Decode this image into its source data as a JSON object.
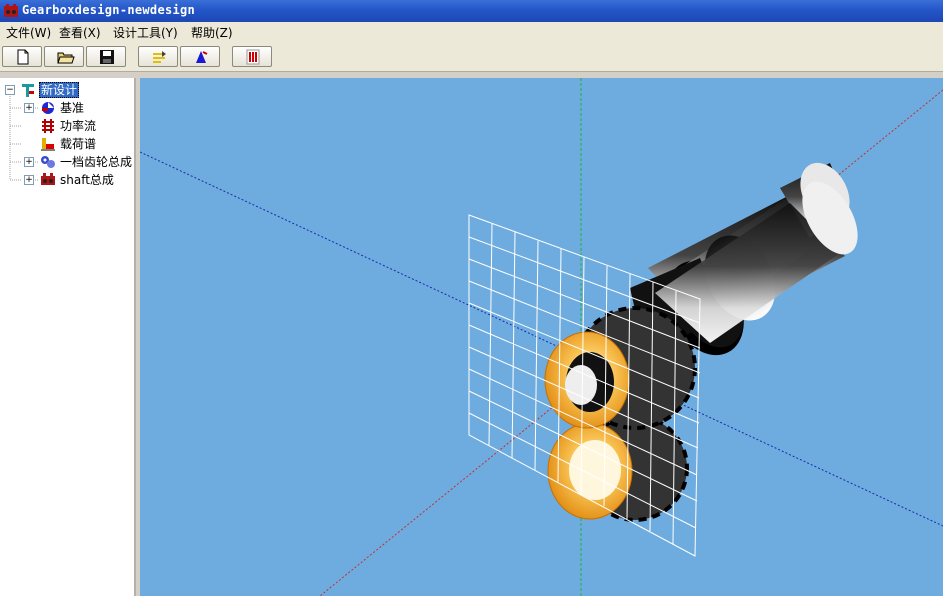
{
  "window": {
    "title": "Gearboxdesign-newdesign",
    "app_icon": "gearbox-app-icon"
  },
  "menu": [
    {
      "label": "文件(W)"
    },
    {
      "label": "查看(X)"
    },
    {
      "label": "设计工具(Y)"
    },
    {
      "label": "帮助(Z)"
    }
  ],
  "toolbar": {
    "buttons": [
      {
        "name": "new-file-button",
        "icon": "new-document-icon"
      },
      {
        "name": "open-file-button",
        "icon": "open-folder-icon"
      },
      {
        "name": "save-file-button",
        "icon": "floppy-disk-icon"
      },
      {
        "name": "power-flow-tool-button",
        "icon": "flow-arrows-icon"
      },
      {
        "name": "load-tool-button",
        "icon": "blue-shape-icon"
      },
      {
        "name": "report-tool-button",
        "icon": "red-list-icon"
      }
    ]
  },
  "tree": {
    "root": {
      "label": "新设计",
      "expanded": true,
      "selected": true
    },
    "items": [
      {
        "label": "基准",
        "expandable": true,
        "icon": "datum-icon"
      },
      {
        "label": "功率流",
        "expandable": false,
        "icon": "power-flow-icon"
      },
      {
        "label": "载荷谱",
        "expandable": false,
        "icon": "load-spectrum-icon"
      },
      {
        "label": "一档齿轮总成",
        "expandable": true,
        "icon": "gear-assembly-icon"
      },
      {
        "label": "shaft总成",
        "expandable": true,
        "icon": "shaft-assembly-icon"
      }
    ]
  },
  "viewport": {
    "background": "#6eacdf",
    "scene": "gear-pair-with-shaft-and-grid-plane",
    "gear_color": "#f5a623",
    "grid_color": "#ffffff"
  }
}
